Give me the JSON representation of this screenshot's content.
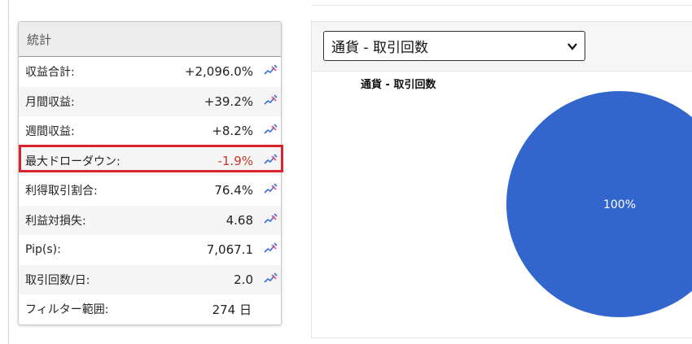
{
  "stats": {
    "title": "統計",
    "rows": [
      {
        "label": "収益合計:",
        "value": "+2,096.0%"
      },
      {
        "label": "月間収益:",
        "value": "+39.2%"
      },
      {
        "label": "週間収益:",
        "value": "+8.2%"
      },
      {
        "label": "最大ドローダウン:",
        "value": "-1.9%"
      },
      {
        "label": "利得取引割合:",
        "value": "76.4%"
      },
      {
        "label": "利益対損失:",
        "value": "4.68"
      },
      {
        "label": "Pip(s):",
        "value": "7,067.1"
      },
      {
        "label": "取引回数/日:",
        "value": "2.0"
      },
      {
        "label": "フィルター範囲:",
        "value": "274 日"
      }
    ],
    "icon": "chart-edit-icon"
  },
  "chart_panel": {
    "select_value": "通貨 - 取引回数",
    "chart_title": "通貨 - 取引回数"
  },
  "chart_data": {
    "type": "pie",
    "title": "通貨 - 取引回数",
    "categories": [
      ""
    ],
    "values": [
      100
    ],
    "labels": [
      "100%"
    ],
    "colors": [
      "#3366cc"
    ]
  },
  "colors": {
    "accent": "#3366cc",
    "negative": "#c0392b",
    "highlight": "#d9232d"
  }
}
